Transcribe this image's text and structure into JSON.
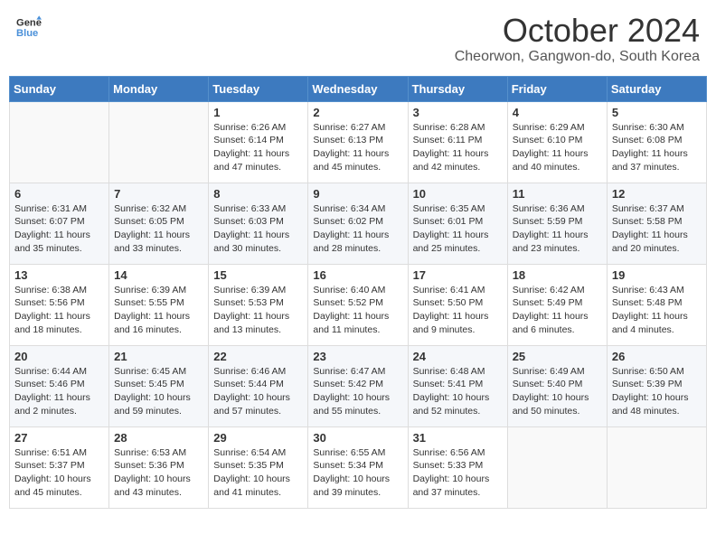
{
  "header": {
    "logo_line1": "General",
    "logo_line2": "Blue",
    "month": "October 2024",
    "location": "Cheorwon, Gangwon-do, South Korea"
  },
  "weekdays": [
    "Sunday",
    "Monday",
    "Tuesday",
    "Wednesday",
    "Thursday",
    "Friday",
    "Saturday"
  ],
  "weeks": [
    [
      {
        "day": "",
        "info": ""
      },
      {
        "day": "",
        "info": ""
      },
      {
        "day": "1",
        "info": "Sunrise: 6:26 AM\nSunset: 6:14 PM\nDaylight: 11 hours and 47 minutes."
      },
      {
        "day": "2",
        "info": "Sunrise: 6:27 AM\nSunset: 6:13 PM\nDaylight: 11 hours and 45 minutes."
      },
      {
        "day": "3",
        "info": "Sunrise: 6:28 AM\nSunset: 6:11 PM\nDaylight: 11 hours and 42 minutes."
      },
      {
        "day": "4",
        "info": "Sunrise: 6:29 AM\nSunset: 6:10 PM\nDaylight: 11 hours and 40 minutes."
      },
      {
        "day": "5",
        "info": "Sunrise: 6:30 AM\nSunset: 6:08 PM\nDaylight: 11 hours and 37 minutes."
      }
    ],
    [
      {
        "day": "6",
        "info": "Sunrise: 6:31 AM\nSunset: 6:07 PM\nDaylight: 11 hours and 35 minutes."
      },
      {
        "day": "7",
        "info": "Sunrise: 6:32 AM\nSunset: 6:05 PM\nDaylight: 11 hours and 33 minutes."
      },
      {
        "day": "8",
        "info": "Sunrise: 6:33 AM\nSunset: 6:03 PM\nDaylight: 11 hours and 30 minutes."
      },
      {
        "day": "9",
        "info": "Sunrise: 6:34 AM\nSunset: 6:02 PM\nDaylight: 11 hours and 28 minutes."
      },
      {
        "day": "10",
        "info": "Sunrise: 6:35 AM\nSunset: 6:01 PM\nDaylight: 11 hours and 25 minutes."
      },
      {
        "day": "11",
        "info": "Sunrise: 6:36 AM\nSunset: 5:59 PM\nDaylight: 11 hours and 23 minutes."
      },
      {
        "day": "12",
        "info": "Sunrise: 6:37 AM\nSunset: 5:58 PM\nDaylight: 11 hours and 20 minutes."
      }
    ],
    [
      {
        "day": "13",
        "info": "Sunrise: 6:38 AM\nSunset: 5:56 PM\nDaylight: 11 hours and 18 minutes."
      },
      {
        "day": "14",
        "info": "Sunrise: 6:39 AM\nSunset: 5:55 PM\nDaylight: 11 hours and 16 minutes."
      },
      {
        "day": "15",
        "info": "Sunrise: 6:39 AM\nSunset: 5:53 PM\nDaylight: 11 hours and 13 minutes."
      },
      {
        "day": "16",
        "info": "Sunrise: 6:40 AM\nSunset: 5:52 PM\nDaylight: 11 hours and 11 minutes."
      },
      {
        "day": "17",
        "info": "Sunrise: 6:41 AM\nSunset: 5:50 PM\nDaylight: 11 hours and 9 minutes."
      },
      {
        "day": "18",
        "info": "Sunrise: 6:42 AM\nSunset: 5:49 PM\nDaylight: 11 hours and 6 minutes."
      },
      {
        "day": "19",
        "info": "Sunrise: 6:43 AM\nSunset: 5:48 PM\nDaylight: 11 hours and 4 minutes."
      }
    ],
    [
      {
        "day": "20",
        "info": "Sunrise: 6:44 AM\nSunset: 5:46 PM\nDaylight: 11 hours and 2 minutes."
      },
      {
        "day": "21",
        "info": "Sunrise: 6:45 AM\nSunset: 5:45 PM\nDaylight: 10 hours and 59 minutes."
      },
      {
        "day": "22",
        "info": "Sunrise: 6:46 AM\nSunset: 5:44 PM\nDaylight: 10 hours and 57 minutes."
      },
      {
        "day": "23",
        "info": "Sunrise: 6:47 AM\nSunset: 5:42 PM\nDaylight: 10 hours and 55 minutes."
      },
      {
        "day": "24",
        "info": "Sunrise: 6:48 AM\nSunset: 5:41 PM\nDaylight: 10 hours and 52 minutes."
      },
      {
        "day": "25",
        "info": "Sunrise: 6:49 AM\nSunset: 5:40 PM\nDaylight: 10 hours and 50 minutes."
      },
      {
        "day": "26",
        "info": "Sunrise: 6:50 AM\nSunset: 5:39 PM\nDaylight: 10 hours and 48 minutes."
      }
    ],
    [
      {
        "day": "27",
        "info": "Sunrise: 6:51 AM\nSunset: 5:37 PM\nDaylight: 10 hours and 45 minutes."
      },
      {
        "day": "28",
        "info": "Sunrise: 6:53 AM\nSunset: 5:36 PM\nDaylight: 10 hours and 43 minutes."
      },
      {
        "day": "29",
        "info": "Sunrise: 6:54 AM\nSunset: 5:35 PM\nDaylight: 10 hours and 41 minutes."
      },
      {
        "day": "30",
        "info": "Sunrise: 6:55 AM\nSunset: 5:34 PM\nDaylight: 10 hours and 39 minutes."
      },
      {
        "day": "31",
        "info": "Sunrise: 6:56 AM\nSunset: 5:33 PM\nDaylight: 10 hours and 37 minutes."
      },
      {
        "day": "",
        "info": ""
      },
      {
        "day": "",
        "info": ""
      }
    ]
  ]
}
